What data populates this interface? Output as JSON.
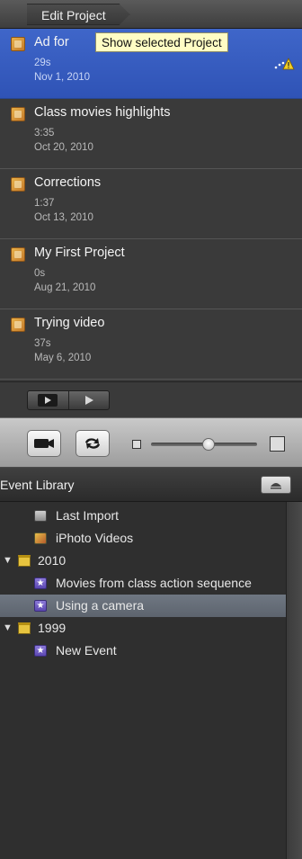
{
  "header": {
    "breadcrumb": "Edit Project"
  },
  "tooltip": "Show selected Project",
  "projects": [
    {
      "title": "Ad for",
      "duration": "29s",
      "date": "Nov 1, 2010"
    },
    {
      "title": "Class movies highlights",
      "duration": "3:35",
      "date": "Oct 20, 2010"
    },
    {
      "title": "Corrections",
      "duration": "1:37",
      "date": "Oct 13, 2010"
    },
    {
      "title": "My First Project",
      "duration": "0s",
      "date": "Aug 21, 2010"
    },
    {
      "title": "Trying video",
      "duration": "37s",
      "date": "May 6, 2010"
    }
  ],
  "event_library": {
    "title": "Event Library",
    "items": [
      {
        "label": "Last Import"
      },
      {
        "label": "iPhoto Videos"
      },
      {
        "label": "2010",
        "disclosure": "▼"
      },
      {
        "label": "Movies from class action sequence"
      },
      {
        "label": "Using a camera"
      },
      {
        "label": "1999",
        "disclosure": "▼"
      },
      {
        "label": "New Event"
      }
    ]
  },
  "zoom": {
    "level": 0.55
  },
  "colors": {
    "selection": "#2f53b6",
    "event_selection": "#5d646e",
    "tooltip_bg": "#fffdc4"
  },
  "icons": [
    "project-icon",
    "warning-icon",
    "full-screen-play-icon",
    "play-icon",
    "camera-icon",
    "swap-icon",
    "small-thumbnail-icon",
    "large-thumbnail-icon",
    "eject-icon",
    "last-import-icon",
    "iphoto-icon",
    "calendar-icon",
    "event-star-icon"
  ]
}
